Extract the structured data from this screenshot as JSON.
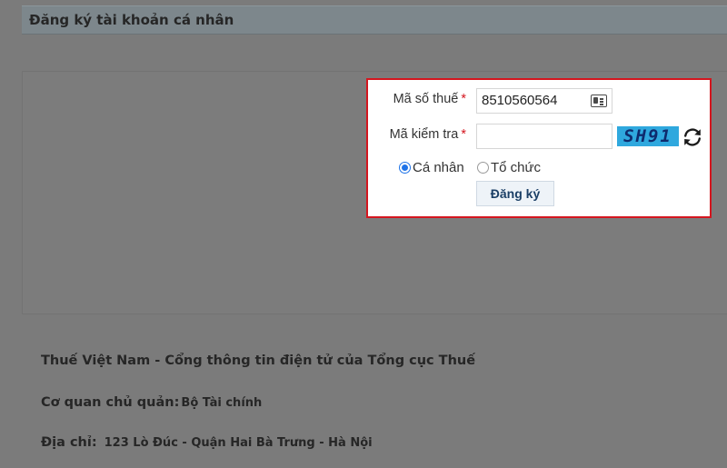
{
  "header": {
    "title": "Đăng ký tài khoản cá nhân"
  },
  "form": {
    "tax_code": {
      "label": "Mã số thuế",
      "required_mark": "*",
      "value": "8510560564",
      "icon": "id-card-icon"
    },
    "captcha": {
      "label": "Mã kiểm tra",
      "required_mark": "*",
      "value": "",
      "code": "SH91",
      "refresh_icon": "refresh-icon"
    },
    "account_type": {
      "options": [
        {
          "label": "Cá nhân",
          "selected": true
        },
        {
          "label": "Tổ chức",
          "selected": false
        }
      ]
    },
    "submit_label": "Đăng ký",
    "highlight_color": "#d4161f"
  },
  "footer": {
    "site_title": "Thuế Việt Nam - Cổng thông tin điện tử của Tổng cục Thuế",
    "agency_label": "Cơ quan chủ quản:",
    "agency_value": "Bộ Tài chính",
    "address_label": "Địa chỉ:",
    "address_value": "123 Lò Đúc - Quận Hai Bà Trưng - Hà Nội"
  }
}
